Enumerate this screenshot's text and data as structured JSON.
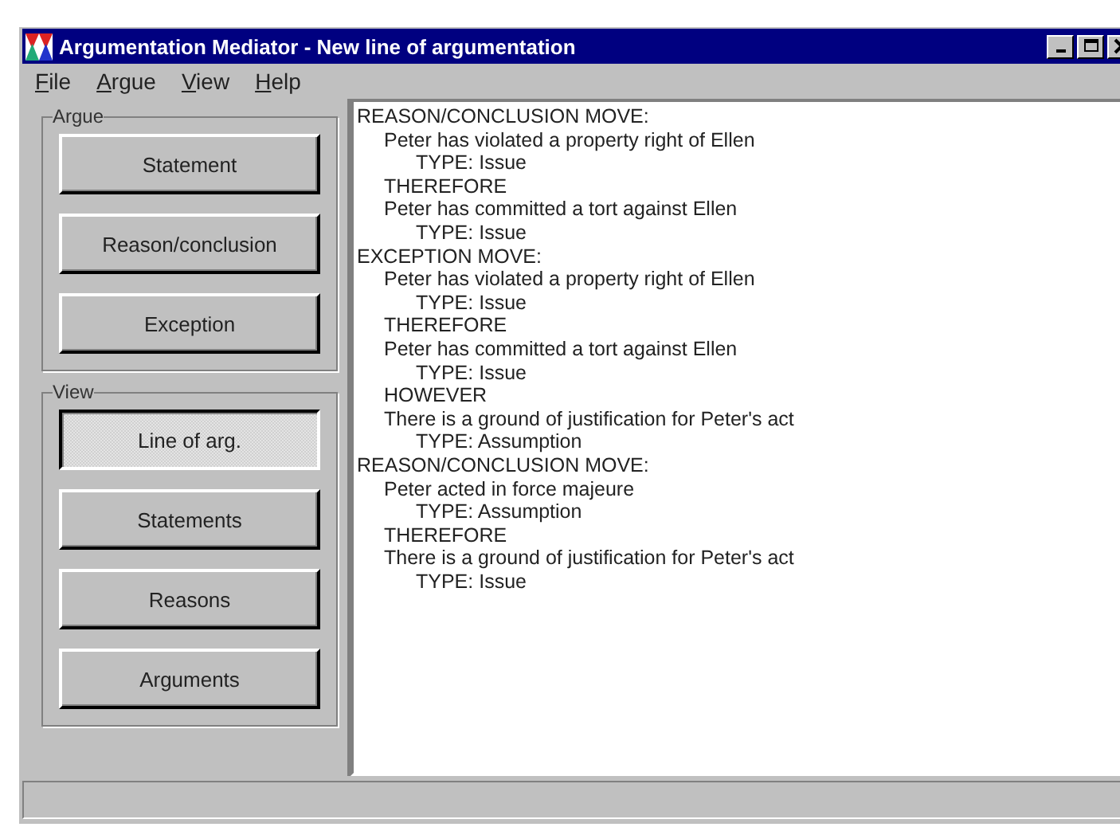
{
  "window": {
    "title": "Argumentation Mediator - New line of argumentation"
  },
  "menu": [
    "File",
    "Argue",
    "View",
    "Help"
  ],
  "argue_group": {
    "title": "Argue",
    "buttons": [
      "Statement",
      "Reason/conclusion",
      "Exception"
    ]
  },
  "view_group": {
    "title": "View",
    "buttons": [
      {
        "label": "Line of arg.",
        "selected": true
      },
      {
        "label": "Statements",
        "selected": false
      },
      {
        "label": "Reasons",
        "selected": false
      },
      {
        "label": "Arguments",
        "selected": false
      }
    ]
  },
  "moves": [
    {
      "heading": "REASON/CONCLUSION MOVE:",
      "lines": [
        {
          "kind": "statement",
          "text": "Peter has violated a property right of Ellen"
        },
        {
          "kind": "type",
          "text": "TYPE: Issue"
        },
        {
          "kind": "connector",
          "text": "THEREFORE"
        },
        {
          "kind": "statement",
          "text": "Peter has committed a tort against Ellen"
        },
        {
          "kind": "type",
          "text": "TYPE: Issue"
        }
      ]
    },
    {
      "heading": "EXCEPTION MOVE:",
      "lines": [
        {
          "kind": "statement",
          "text": "Peter has violated a property right of Ellen"
        },
        {
          "kind": "type",
          "text": "TYPE: Issue"
        },
        {
          "kind": "connector",
          "text": "THEREFORE"
        },
        {
          "kind": "statement",
          "text": "Peter has committed a tort against Ellen"
        },
        {
          "kind": "type",
          "text": "TYPE: Issue"
        },
        {
          "kind": "connector",
          "text": "HOWEVER"
        },
        {
          "kind": "statement",
          "text": "There is a ground of justification for Peter's act"
        },
        {
          "kind": "type",
          "text": "TYPE: Assumption"
        }
      ]
    },
    {
      "heading": "REASON/CONCLUSION MOVE:",
      "lines": [
        {
          "kind": "statement",
          "text": "Peter acted in force majeure"
        },
        {
          "kind": "type",
          "text": "TYPE: Assumption"
        },
        {
          "kind": "connector",
          "text": "THEREFORE"
        },
        {
          "kind": "statement",
          "text": "There is a ground of justification for Peter's act"
        },
        {
          "kind": "type",
          "text": "TYPE: Issue"
        }
      ]
    }
  ]
}
